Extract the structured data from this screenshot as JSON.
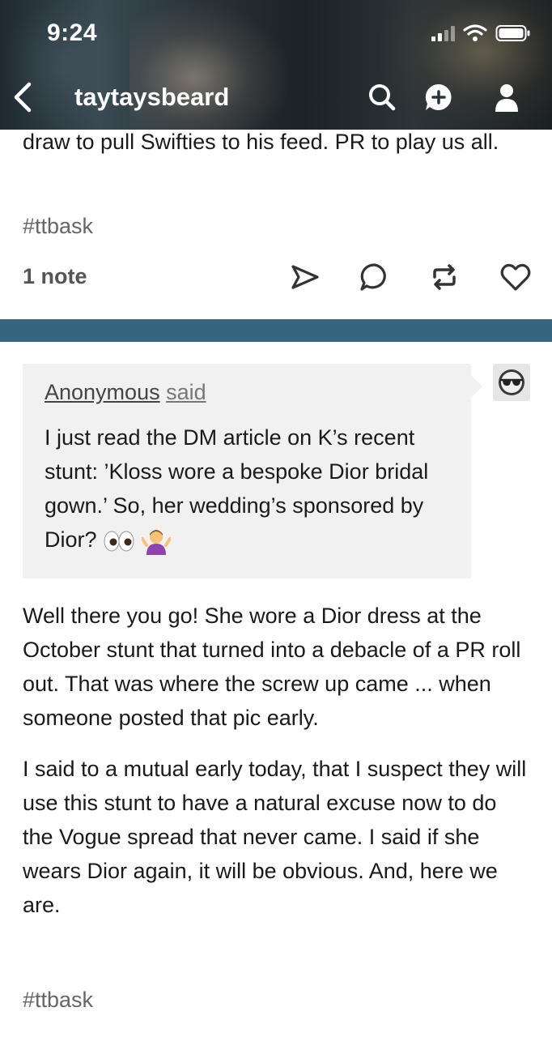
{
  "status_bar": {
    "time": "9:24"
  },
  "nav": {
    "blog_name": "taytaysbeard"
  },
  "prev_post": {
    "text": "draw to pull Swifties to his feed. PR to play us all.",
    "tag": "#ttbask",
    "notes": "1 note"
  },
  "ask": {
    "asker": "Anonymous",
    "said": "said",
    "question": "I just read the DM article on K’s recent stunt: ’Kloss wore a bespoke Dior bridal gown.’ So, her wedding’s sponsored by Dior?"
  },
  "answer": {
    "paragraph1": "Well there you go! She wore a Dior dress at the October stunt that turned into a debacle of a PR roll out. That was where the screw up came ... when someone posted that pic early.",
    "paragraph2": "I said to a mutual early today, that I suspect they will use this stunt to have a natural excuse now to do the Vogue spread that never came. I said if she wears Dior again, it will be obvious. And, here we are.",
    "tag": "#ttbask"
  },
  "colors": {
    "divider": "#35647e",
    "ask_bg": "#f1f1f1"
  }
}
